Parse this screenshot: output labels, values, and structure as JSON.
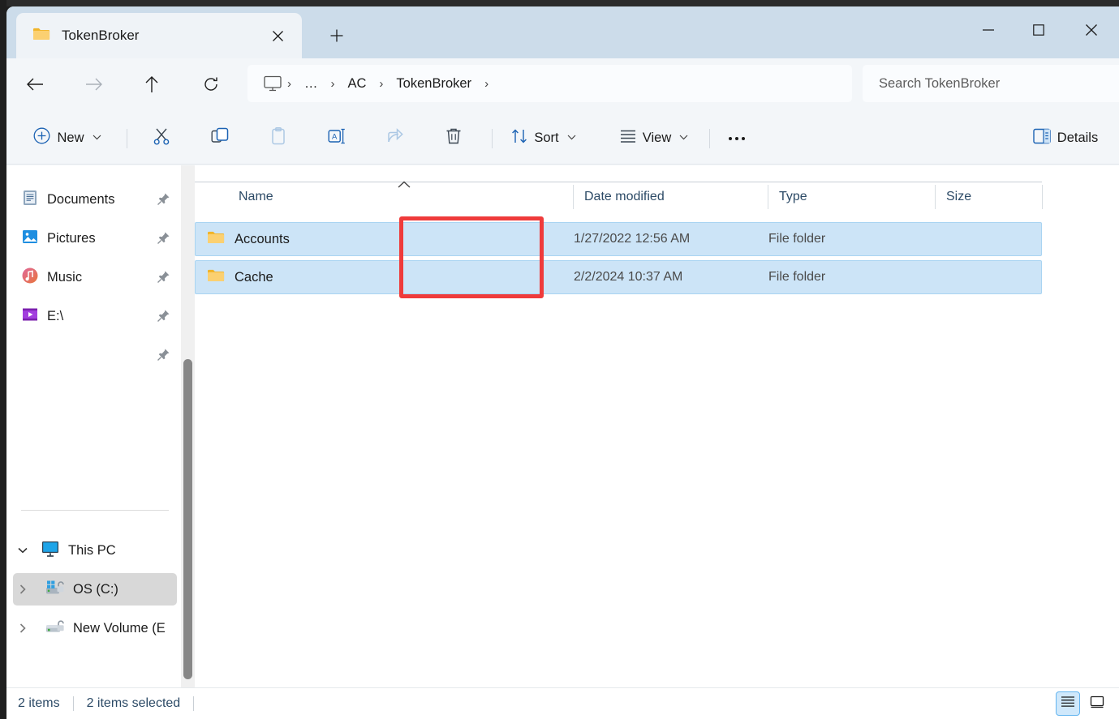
{
  "window": {
    "tab_title": "TokenBroker",
    "tab_close_label": "×",
    "newtab_label": "+",
    "minimize_label": "—",
    "maximize_label": "□",
    "close_label": "✕"
  },
  "nav": {
    "back_label": "←",
    "forward_label": "→",
    "up_label": "↑",
    "refresh_label": "↻"
  },
  "address": {
    "crumbs": [
      {
        "label": "",
        "icon": "this-pc-icon"
      },
      {
        "label": "…",
        "icon": ""
      },
      {
        "label": "AC",
        "icon": ""
      },
      {
        "label": "TokenBroker",
        "icon": ""
      }
    ],
    "separator": "›"
  },
  "search": {
    "placeholder": "Search TokenBroker",
    "value": ""
  },
  "toolbar": {
    "new_label": "New",
    "cut_label": "Cut",
    "copy_label": "Copy",
    "paste_label": "Paste",
    "rename_label": "Rename",
    "share_label": "Share",
    "delete_label": "Delete",
    "sort_label": "Sort",
    "view_label": "View",
    "more_label": "•••",
    "details_label": "Details",
    "chevron": "⌄"
  },
  "sidebar": {
    "quick_items": [
      {
        "label": "Documents",
        "icon": "documents-icon",
        "pinned": true
      },
      {
        "label": "Pictures",
        "icon": "pictures-icon",
        "pinned": true
      },
      {
        "label": "Music",
        "icon": "music-icon",
        "pinned": true
      },
      {
        "label": "E:\\",
        "icon": "drive-video-icon",
        "pinned": true
      },
      {
        "label": "",
        "icon": "",
        "pinned": true
      }
    ],
    "this_pc": {
      "label": "This PC",
      "icon": "this-pc-icon",
      "expanded": true,
      "expander": "⌄",
      "children": [
        {
          "label": "OS (C:)",
          "icon": "os-drive-icon",
          "expander": "›",
          "hovered": true
        },
        {
          "label": "New Volume (E",
          "icon": "drive-icon",
          "expander": "›",
          "hovered": false
        }
      ]
    }
  },
  "filelist": {
    "columns": [
      {
        "label": "Name",
        "sorted": "asc",
        "sort_glyph": "⌃"
      },
      {
        "label": "Date modified",
        "sorted": ""
      },
      {
        "label": "Type",
        "sorted": ""
      },
      {
        "label": "Size",
        "sorted": ""
      }
    ],
    "rows": [
      {
        "name": "Accounts",
        "date_modified": "1/27/2022 12:56 AM",
        "type": "File folder",
        "size": "",
        "icon": "folder-icon",
        "selected": true
      },
      {
        "name": "Cache",
        "date_modified": "2/2/2024 10:37 AM",
        "type": "File folder",
        "size": "",
        "icon": "folder-icon",
        "selected": true
      }
    ]
  },
  "status": {
    "item_count": "2 items",
    "selection": "2 items selected"
  },
  "view_toggles": {
    "details_view": "details-view-icon",
    "large_icons_view": "large-icons-view-icon",
    "active": "details"
  },
  "colors": {
    "titlebar": "#ccdcea",
    "chrome": "#f3f6f9",
    "selection": "#cce4f7",
    "selection_border": "#a9d4f2",
    "annotation_red": "#ef3b3b",
    "accent_blue": "#0f6cbd",
    "folder_yellow": "#f6c34a"
  }
}
